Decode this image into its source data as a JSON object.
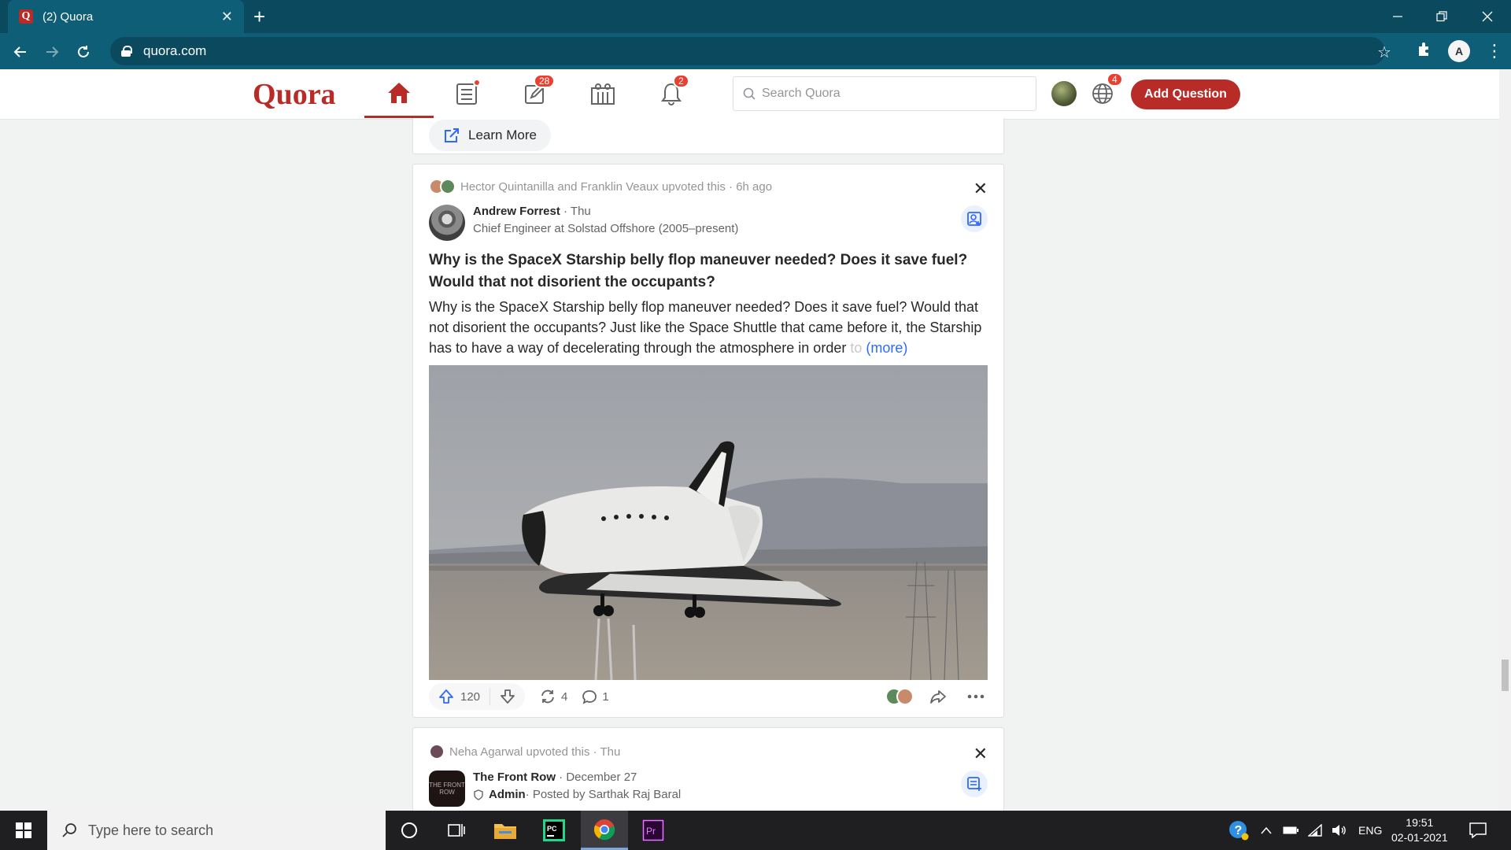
{
  "browser": {
    "tab_title": "(2) Quora",
    "url": "quora.com",
    "new_tab_symbol": "+",
    "close_tab_symbol": "✕"
  },
  "quora": {
    "logo": "Quora",
    "search_placeholder": "Search Quora",
    "add_question_label": "Add Question",
    "badges": {
      "answer": "28",
      "notifications": "2",
      "language": "4"
    },
    "brand_color": "#b92b27"
  },
  "feed": {
    "prev_card": {
      "learn_more_label": "Learn More"
    },
    "post1": {
      "upvoted_line": "Hector Quintanilla and Franklin Veaux upvoted this · 6h ago",
      "author_name": "Andrew Forrest",
      "author_meta": " · Thu",
      "credential": "Chief Engineer at Solstad Offshore (2005–present)",
      "question": "Why is the SpaceX Starship belly flop maneuver needed? Does it save fuel? Would that not disorient the occupants?",
      "excerpt": "Why is the SpaceX Starship belly flop maneuver needed? Does it save fuel? Would that not disorient the occupants? Just like the Space Shuttle that came before it, the Starship has to have a way of decelerating through the atmosphere in order",
      "excerpt_fade": " to",
      "more_label": "(more)",
      "upvotes": "120",
      "shares": "4",
      "comments": "1"
    },
    "post2": {
      "upvoted_line": "Neha Agarwal upvoted this · Thu",
      "space_name": "The Front Row",
      "space_meta": " · December 27",
      "admin_label": "Admin",
      "posted_by": " · Posted by Sarthak Raj Baral",
      "space_logo_text": "THE FRONT ROW"
    }
  },
  "taskbar": {
    "search_placeholder": "Type here to search",
    "language": "ENG",
    "time": "19:51",
    "date": "02-01-2021"
  }
}
